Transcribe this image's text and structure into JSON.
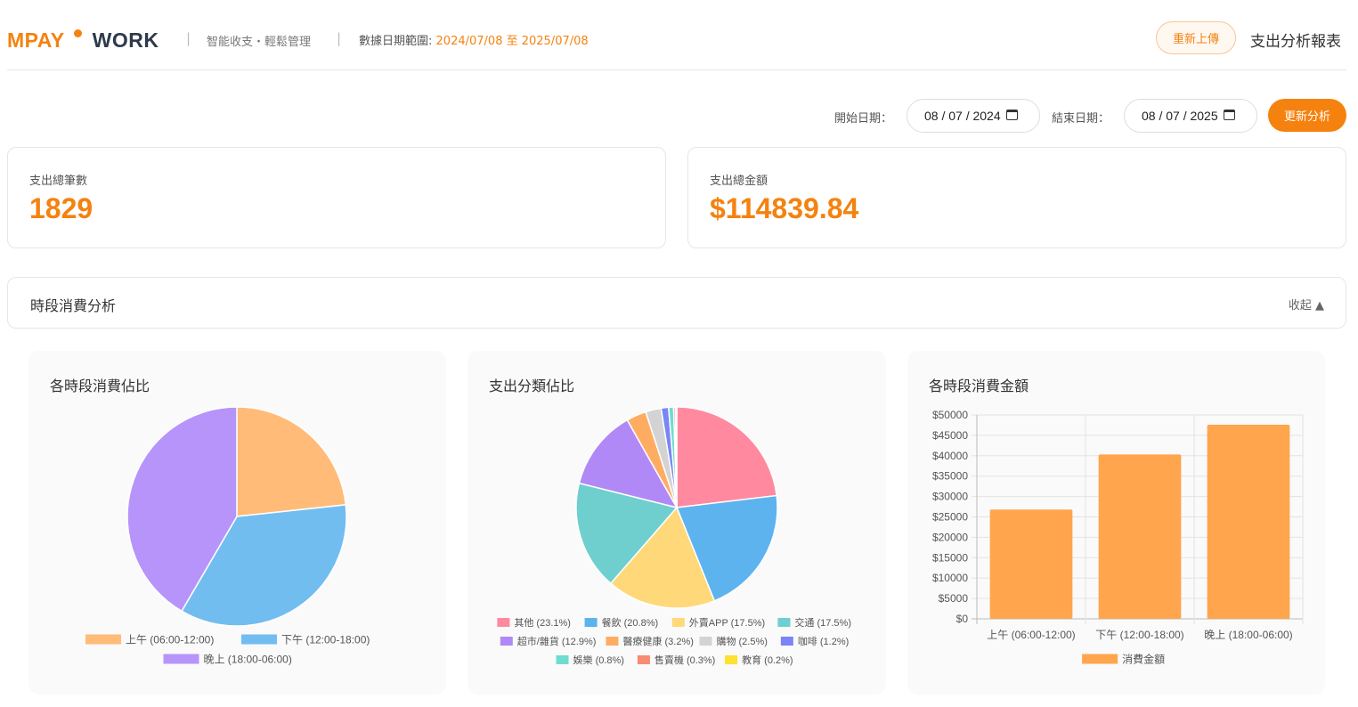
{
  "header": {
    "logo_part1": "MPAY",
    "logo_part2": "WORK",
    "separator": "|",
    "slogan": "智能收支・輕鬆管理",
    "range_label": "數據日期範圍:",
    "range_value": "2024/07/08 至 2025/07/08",
    "reupload_label": "重新上傳",
    "report_title": "支出分析報表"
  },
  "filters": {
    "start_label": "開始日期：",
    "start_value": "08 / 07 / 2024",
    "end_label": "結束日期：",
    "end_value": "08 / 07 / 2025",
    "update_label": "更新分析"
  },
  "stats": {
    "count_label": "支出總筆數",
    "count_value": "1829",
    "total_label": "支出總金額",
    "total_value": "$114839.84"
  },
  "section": {
    "title": "時段消費分析",
    "collapse_label": "收起 ▲"
  },
  "colors": {
    "accent": "#f5820f"
  },
  "chart_data": [
    {
      "type": "pie",
      "title": "各時段消費佔比",
      "labels": [
        "上午 (06:00-12:00)",
        "下午 (12:00-18:00)",
        "晚上 (18:00-06:00)"
      ],
      "values": [
        23.3,
        35.1,
        41.6
      ],
      "colors": [
        "#ffbb77",
        "#72bdf0",
        "#b794fa"
      ]
    },
    {
      "type": "pie",
      "title": "支出分類佔比",
      "labels": [
        "其他 (23.1%)",
        "餐飲 (20.8%)",
        "外賣APP (17.5%)",
        "交通 (17.5%)",
        "超市/雜貨 (12.9%)",
        "醫療健康 (3.2%)",
        "購物 (2.5%)",
        "咖啡 (1.2%)",
        "娛樂 (0.8%)",
        "售賣機 (0.3%)",
        "教育 (0.2%)"
      ],
      "values": [
        23.1,
        20.8,
        17.5,
        17.5,
        12.9,
        3.2,
        2.5,
        1.2,
        0.8,
        0.3,
        0.2
      ],
      "colors": [
        "#ff8aa0",
        "#5db3ee",
        "#ffd879",
        "#6fcfcf",
        "#b189f7",
        "#ffac63",
        "#d3d3d3",
        "#7a85f7",
        "#6fdcd0",
        "#f78b73",
        "#ffe033"
      ]
    },
    {
      "type": "bar",
      "title": "各時段消費金額",
      "categories": [
        "上午 (06:00-12:00)",
        "下午 (12:00-18:00)",
        "晚上 (18:00-06:00)"
      ],
      "series": [
        {
          "name": "消費金額",
          "values": [
            26800,
            40300,
            47600
          ]
        }
      ],
      "ylim": [
        0,
        50000
      ],
      "yticks": [
        "$0",
        "$5000",
        "$10000",
        "$15000",
        "$20000",
        "$25000",
        "$30000",
        "$35000",
        "$40000",
        "$45000",
        "$50000"
      ],
      "color": "#ffa54d",
      "grid": true,
      "legend": "bottom"
    }
  ]
}
